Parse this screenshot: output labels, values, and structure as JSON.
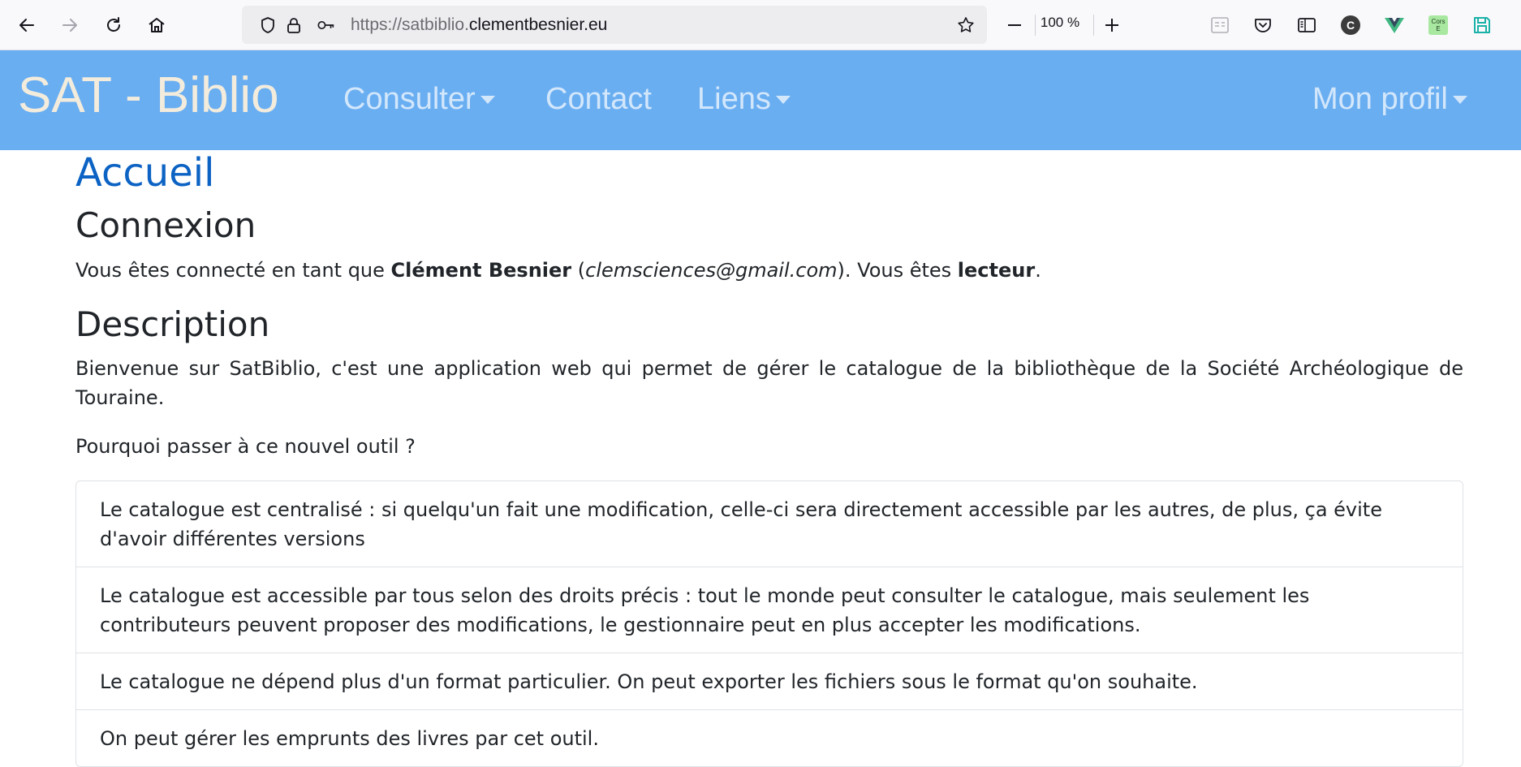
{
  "browser": {
    "url_scheme": "https://",
    "url_subdomain": "satbiblio.",
    "url_domain": "clementbesnier.eu",
    "zoom": "100 %",
    "icons": [
      "back-icon",
      "forward-icon",
      "reload-icon",
      "home-icon",
      "shield-icon",
      "lock-icon",
      "key-icon",
      "bookmark-star-icon",
      "zoom-out-icon",
      "zoom-in-icon",
      "reader-view-icon",
      "pocket-icon",
      "sidebar-icon",
      "extension-c-icon",
      "vue-devtools-icon",
      "cors-extension-icon",
      "save-icon"
    ],
    "cors_label_top": "Cors",
    "cors_label_bottom": "E",
    "ext_c_label": "C"
  },
  "navbar": {
    "brand": "SAT - Biblio",
    "links": [
      {
        "label": "Consulter",
        "dropdown": true
      },
      {
        "label": "Contact",
        "dropdown": false
      },
      {
        "label": "Liens",
        "dropdown": true
      }
    ],
    "profile": "Mon profil",
    "colors": {
      "background": "#6aaef2",
      "brand": "#f3ecdc",
      "link": "#d3e7fb"
    }
  },
  "page": {
    "title": "Accueil",
    "connexion": {
      "heading": "Connexion",
      "prefix": "Vous êtes connecté en tant que ",
      "name": "Clément Besnier",
      "open_paren": " (",
      "email": "clemsciences@gmail.com",
      "middle": "). Vous êtes ",
      "role": "lecteur",
      "suffix": "."
    },
    "description": {
      "heading": "Description",
      "intro": "Bienvenue sur SatBiblio, c'est une application web qui permet de gérer le catalogue de la bibliothèque de la Société Archéologique de Touraine.",
      "question": "Pourquoi passer à ce nouvel outil ?",
      "reasons": [
        "Le catalogue est centralisé : si quelqu'un fait une modification, celle-ci sera directement accessible par les autres, de plus, ça évite d'avoir différentes versions",
        "Le catalogue est accessible par tous selon des droits précis : tout le monde peut consulter le catalogue, mais seulement les contributeurs peuvent proposer des modifications, le gestionnaire peut en plus accepter les modifications.",
        "Le catalogue ne dépend plus d'un format particulier. On peut exporter les fichiers sous le format qu'on souhaite.",
        "On peut gérer les emprunts des livres par cet outil."
      ]
    },
    "colors": {
      "title": "#0c63c4",
      "text": "#212529",
      "border": "#dee2e6"
    }
  }
}
